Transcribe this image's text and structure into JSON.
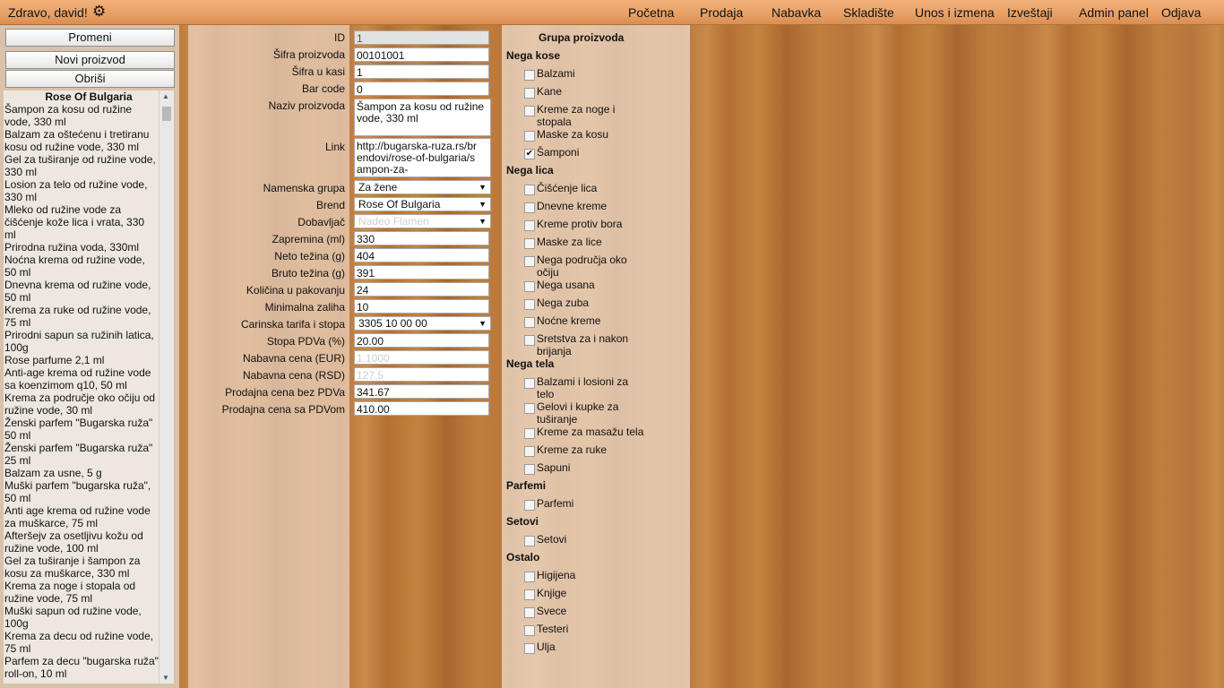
{
  "header": {
    "greeting": "Zdravo, david!",
    "settings_icon": "gear-icon",
    "nav": [
      "Početna",
      "Prodaja",
      "Nabavka",
      "Skladište",
      "Unos i izmena",
      "Izveštaji",
      "Admin panel",
      "Odjava"
    ]
  },
  "left": {
    "buttons": [
      "Promeni",
      "Novi proizvod",
      "Obriši"
    ],
    "list_title": "Rose Of Bulgaria",
    "items": [
      "Šampon za kosu od ružine vode, 330 ml",
      "Balzam za oštećenu i tretiranu kosu od ružine vode, 330 ml",
      "Gel za tuširanje od ružine vode, 330 ml",
      "Losion za telo od ružine vode, 330 ml",
      "Mleko od ružine vode za čišćenje kože lica i vrata, 330 ml",
      "Prirodna ružina voda, 330ml",
      "Noćna krema od ružine vode, 50 ml",
      "Dnevna krema od ružine vode, 50 ml",
      "Krema za ruke od ružine vode, 75 ml",
      "Prirodni sapun sa ružinih latica, 100g",
      "Rose parfume 2,1 ml",
      "Anti-age krema od ružine vode sa koenzimom q10, 50 ml",
      "Krema za područje oko očiju od ružine vode, 30 ml",
      "Ženski parfem \"Bugarska ruža\" 50 ml",
      "Ženski parfem \"Bugarska ruža\" 25 ml",
      "Balzam za usne, 5 g",
      "Muški parfem \"bugarska ruža\", 50 ml",
      "Anti age krema od ružine vode za muškarce, 75 ml",
      "Afteršejv za osetljivu kožu od ružine vode, 100 ml",
      "Gel za tuširanje i šampon za kosu za muškarce, 330 ml",
      "Krema za noge i stopala od ružine vode, 75 ml",
      "Muški sapun od ružine vode, 100g",
      "Krema za decu od ružine vode, 75 ml",
      "Parfem za decu \"bugarska ruža\" roll-on, 10 ml"
    ]
  },
  "form": {
    "id_label": "ID",
    "id_value": "1",
    "sifra_label": "Šifra proizvoda",
    "sifra_value": "00101001",
    "kasa_label": "Šifra u kasi",
    "kasa_value": "1",
    "barcode_label": "Bar code",
    "barcode_value": "0",
    "naziv_label": "Naziv proizvoda",
    "naziv_value": "Šampon za kosu od ružine vode, 330 ml",
    "link_label": "Link",
    "link_value": "http://bugarska-ruza.rs/brendovi/rose-of-bulgaria/sampon-za-",
    "grupa_label": "Namenska grupa",
    "grupa_value": "Za žene",
    "brend_label": "Brend",
    "brend_value": "Rose Of Bulgaria",
    "dobavljac_label": "Dobavljač",
    "dobavljac_value": "Nadeo Flamen",
    "zapremina_label": "Zapremina (ml)",
    "zapremina_value": "330",
    "neto_label": "Neto težina (g)",
    "neto_value": "404",
    "bruto_label": "Bruto težina (g)",
    "bruto_value": "391",
    "pakovanje_label": "Količina u pakovanju",
    "pakovanje_value": "24",
    "zaliha_label": "Minimalna zaliha",
    "zaliha_value": "10",
    "tarifa_label": "Carinska tarifa i stopa",
    "tarifa_value": "3305 10 00 00",
    "pdv_label": "Stopa PDVa (%)",
    "pdv_value": "20.00",
    "eur_label": "Nabavna cena (EUR)",
    "eur_value": "1.1000",
    "rsd_label": "Nabavna cena (RSD)",
    "rsd_value": "127.5",
    "bezpdv_label": "Prodajna cena bez PDVa",
    "bezpdv_value": "341.67",
    "sapdv_label": "Prodajna cena sa PDVom",
    "sapdv_value": "410.00"
  },
  "groups": {
    "title": "Grupa proizvoda",
    "categories": [
      {
        "name": "Nega kose",
        "items": [
          {
            "label": "Balzami",
            "checked": false
          },
          {
            "label": "Kane",
            "checked": false
          },
          {
            "label": "Kreme za noge i stopala",
            "checked": false
          },
          {
            "label": "Maske za kosu",
            "checked": false
          },
          {
            "label": "Šamponi",
            "checked": true
          }
        ]
      },
      {
        "name": "Nega lica",
        "items": [
          {
            "label": "Čišćenje lica",
            "checked": false
          },
          {
            "label": "Dnevne kreme",
            "checked": false
          },
          {
            "label": "Kreme protiv bora",
            "checked": false
          },
          {
            "label": "Maske za lice",
            "checked": false
          },
          {
            "label": "Nega područja oko očiju",
            "checked": false
          },
          {
            "label": "Nega usana",
            "checked": false
          },
          {
            "label": "Nega zuba",
            "checked": false
          },
          {
            "label": "Noćne kreme",
            "checked": false
          },
          {
            "label": "Sretstva za i nakon brijanja",
            "checked": false
          }
        ]
      },
      {
        "name": "Nega tela",
        "items": [
          {
            "label": "Balzami i losioni za telo",
            "checked": false
          },
          {
            "label": "Gelovi i kupke za tuširanje",
            "checked": false
          },
          {
            "label": "Kreme za masažu tela",
            "checked": false
          },
          {
            "label": "Kreme za ruke",
            "checked": false
          },
          {
            "label": "Sapuni",
            "checked": false
          }
        ]
      },
      {
        "name": "Parfemi",
        "items": [
          {
            "label": "Parfemi",
            "checked": false
          }
        ]
      },
      {
        "name": "Setovi",
        "items": [
          {
            "label": "Setovi",
            "checked": false
          }
        ]
      },
      {
        "name": "Ostalo",
        "items": [
          {
            "label": "Higijena",
            "checked": false
          },
          {
            "label": "Knjige",
            "checked": false
          },
          {
            "label": "Svece",
            "checked": false
          },
          {
            "label": "Testeri",
            "checked": false
          },
          {
            "label": "Ulja",
            "checked": false
          }
        ]
      }
    ]
  }
}
